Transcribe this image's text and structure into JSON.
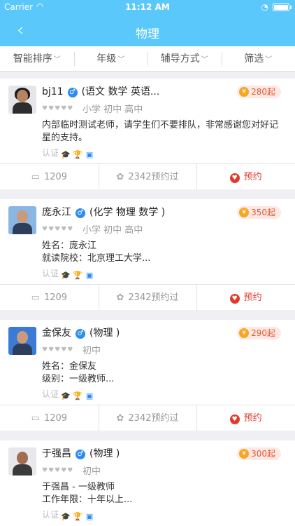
{
  "status": {
    "carrier": "Carrier",
    "time": "11:12 AM"
  },
  "nav": {
    "title": "物理"
  },
  "filters": [
    {
      "label": "智能排序"
    },
    {
      "label": "年级"
    },
    {
      "label": "辅导方式"
    },
    {
      "label": "筛选"
    }
  ],
  "teachers": [
    {
      "name": "bj11",
      "subjects": "(语文 数学 英语...",
      "price": "280起",
      "grades": "小学 初中 高中",
      "intro": [
        "内部临时测试老师，请学生们不要排队，非常感谢您对好记",
        "星的支持。"
      ],
      "cert_label": "认证",
      "comments": "1209",
      "booked": "2342预约过",
      "book_label": "预约"
    },
    {
      "name": "庞永江",
      "subjects": "(化学 物理 数学 )",
      "price": "350起",
      "grades": "小学 初中 高中",
      "intro": [
        "姓名：庞永江",
        "就读院校：北京理工大学..."
      ],
      "cert_label": "认证",
      "comments": "1209",
      "booked": "2342预约过",
      "book_label": "预约"
    },
    {
      "name": "金保友",
      "subjects": "(物理 )",
      "price": "290起",
      "grades": "初中",
      "intro": [
        "姓名：金保友",
        "级别：一级教师..."
      ],
      "cert_label": "认证",
      "comments": "1209",
      "booked": "2342预约过",
      "book_label": "预约"
    },
    {
      "name": "于强昌",
      "subjects": "(物理 )",
      "price": "300起",
      "grades": "初中",
      "intro": [
        "于强昌 - 一级教师",
        "工作年限：十年以上..."
      ],
      "cert_label": "认证"
    }
  ],
  "icons": {
    "back": "chevron-left-icon",
    "gender": "male-icon",
    "price": "yuan-icon",
    "comment": "comment-icon",
    "booked": "booked-icon",
    "book": "heart-icon"
  },
  "colors": {
    "accent": "#5ac8fa",
    "price": "#e25a37",
    "book": "#e03b2e",
    "male": "#2b8cf3"
  }
}
